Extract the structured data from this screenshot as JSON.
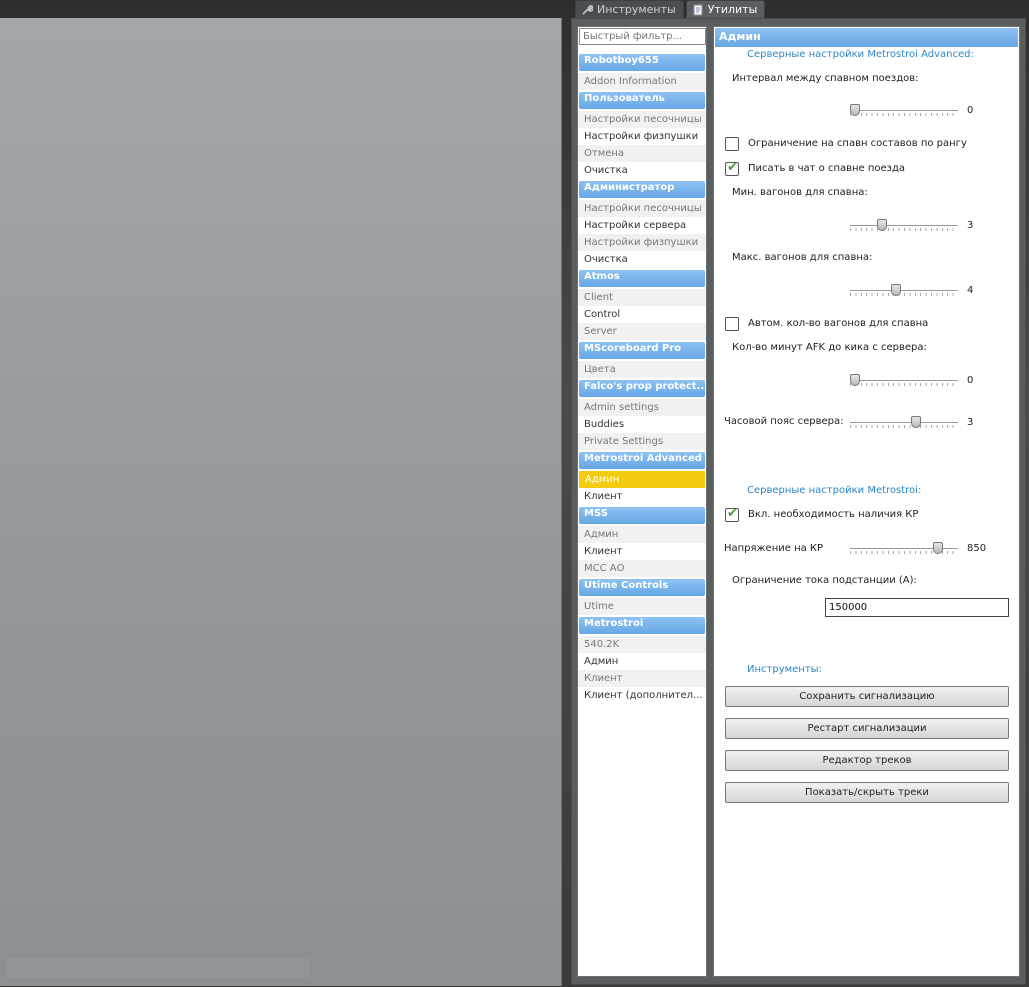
{
  "tabs": [
    {
      "label": "Инструменты",
      "icon": "wrench-icon",
      "active": false
    },
    {
      "label": "Утилиты",
      "icon": "page-icon",
      "active": true
    }
  ],
  "sidebar": {
    "filter_placeholder": "Быстрый фильтр...",
    "categories": [
      {
        "title": "Robotboy655",
        "items": [
          "Addon Information"
        ]
      },
      {
        "title": "Пользователь",
        "items": [
          "Настройки песочницы",
          "Настройки физпушки",
          "Отмена",
          "Очистка"
        ]
      },
      {
        "title": "Администратор",
        "items": [
          "Настройки песочницы",
          "Настройки сервера",
          "Настройки физпушки",
          "Очистка"
        ]
      },
      {
        "title": "Atmos",
        "items": [
          "Client",
          "Control",
          "Server"
        ]
      },
      {
        "title": "MScoreboard Pro",
        "items": [
          "Цвета"
        ]
      },
      {
        "title": "Falco's prop protect...",
        "items": [
          "Admin settings",
          "Buddies",
          "Private Settings"
        ]
      },
      {
        "title": "Metrostroi Advanced",
        "items": [
          "Админ",
          "Клиент"
        ]
      },
      {
        "title": "MSS",
        "items": [
          "Админ",
          "Клиент",
          "МСС АО"
        ]
      },
      {
        "title": "Utime Controls",
        "items": [
          "Utime"
        ]
      },
      {
        "title": "Metrostroi",
        "items": [
          "540.2K",
          "Админ",
          "Клиент",
          "Клиент (дополнител..."
        ]
      }
    ],
    "selected": "Metrostroi Advanced/Админ"
  },
  "content": {
    "header": "Админ",
    "section1_title": "Серверные настройки Metrostroi Advanced:",
    "spawn_interval": {
      "label": "Интервал между спавном поездов:",
      "value": "0",
      "fraction": 0.0
    },
    "rank_limit": {
      "label": "Ограничение на спавн составов по рангу",
      "checked": false
    },
    "chat_notify": {
      "label": "Писать в чат о спавне поезда",
      "checked": true
    },
    "min_wagons": {
      "label": "Мин. вагонов для спавна:",
      "value": "3",
      "fraction": 0.28
    },
    "max_wagons": {
      "label": "Макс. вагонов для спавна:",
      "value": "4",
      "fraction": 0.42
    },
    "auto_wagons": {
      "label": "Автом. кол-во вагонов для спавна",
      "checked": false
    },
    "afk_minutes": {
      "label": "Кол-во минут AFK до кика с сервера:",
      "value": "0",
      "fraction": 0.0
    },
    "timezone": {
      "label": "Часовой пояс сервера:",
      "value": "3",
      "fraction": 0.62
    },
    "section2_title": "Серверные настройки Metrostroi:",
    "require_kr": {
      "label": "Вкл. необходимость наличия КР",
      "checked": true
    },
    "kr_voltage": {
      "label": "Напряжение на КР",
      "value": "850",
      "fraction": 0.85
    },
    "substation_limit": {
      "label": "Ограничение тока подстанции (А):",
      "value": "150000"
    },
    "tools_title": "Инструменты:",
    "buttons": {
      "save_alarm": "Сохранить сигнализацию",
      "restart_alarm": "Рестарт сигнализации",
      "track_editor": "Редактор треков",
      "toggle_tracks": "Показать/скрыть треки"
    }
  },
  "colors": {
    "category_header": "#66a7e4",
    "selected_item": "#f3cc12",
    "section_title": "#2d86c8",
    "check": "#4c9a3a"
  }
}
